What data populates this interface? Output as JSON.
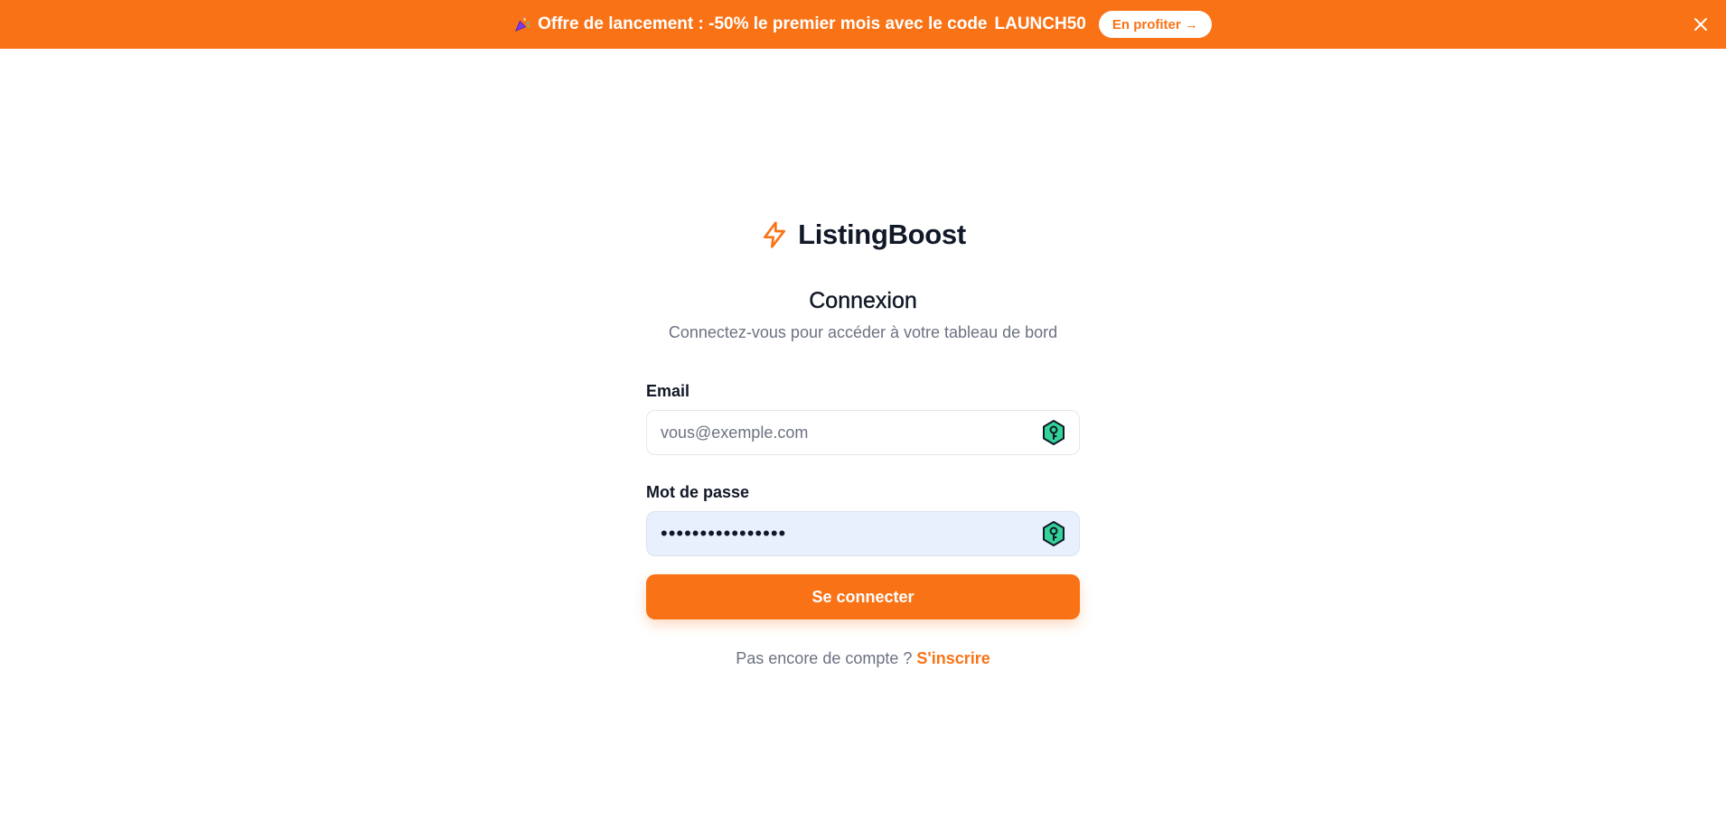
{
  "banner": {
    "icon": "party-popper-icon",
    "text_prefix": "Offre de lancement : -50% le premier mois avec le code",
    "code": "LAUNCH50",
    "cta_label": "En profiter →",
    "background": "#f97316"
  },
  "brand": {
    "name": "ListingBoost",
    "icon": "lightning-bolt-icon",
    "accent": "#f97316"
  },
  "login": {
    "title": "Connexion",
    "subtitle": "Connectez-vous pour accéder à votre tableau de bord",
    "email_label": "Email",
    "email_placeholder": "vous@exemple.com",
    "email_value": "",
    "password_label": "Mot de passe",
    "password_value": "••••••••••••••••",
    "submit_label": "Se connecter",
    "signup_prompt": "Pas encore de compte ?",
    "signup_link": "S'inscrire"
  }
}
